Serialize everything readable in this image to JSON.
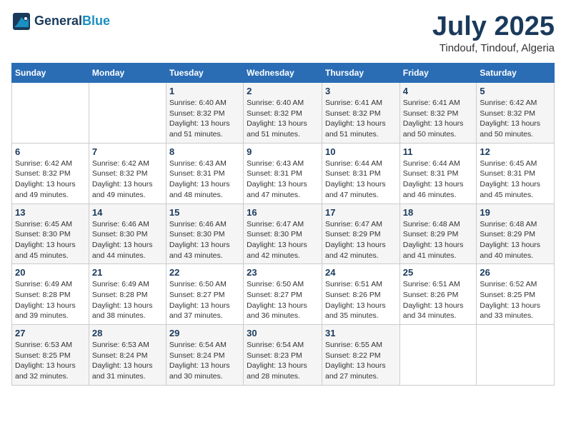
{
  "header": {
    "logo_line1": "General",
    "logo_line2": "Blue",
    "month": "July 2025",
    "location": "Tindouf, Tindouf, Algeria"
  },
  "weekdays": [
    "Sunday",
    "Monday",
    "Tuesday",
    "Wednesday",
    "Thursday",
    "Friday",
    "Saturday"
  ],
  "weeks": [
    [
      {
        "day": "",
        "info": ""
      },
      {
        "day": "",
        "info": ""
      },
      {
        "day": "1",
        "info": "Sunrise: 6:40 AM\nSunset: 8:32 PM\nDaylight: 13 hours and 51 minutes."
      },
      {
        "day": "2",
        "info": "Sunrise: 6:40 AM\nSunset: 8:32 PM\nDaylight: 13 hours and 51 minutes."
      },
      {
        "day": "3",
        "info": "Sunrise: 6:41 AM\nSunset: 8:32 PM\nDaylight: 13 hours and 51 minutes."
      },
      {
        "day": "4",
        "info": "Sunrise: 6:41 AM\nSunset: 8:32 PM\nDaylight: 13 hours and 50 minutes."
      },
      {
        "day": "5",
        "info": "Sunrise: 6:42 AM\nSunset: 8:32 PM\nDaylight: 13 hours and 50 minutes."
      }
    ],
    [
      {
        "day": "6",
        "info": "Sunrise: 6:42 AM\nSunset: 8:32 PM\nDaylight: 13 hours and 49 minutes."
      },
      {
        "day": "7",
        "info": "Sunrise: 6:42 AM\nSunset: 8:32 PM\nDaylight: 13 hours and 49 minutes."
      },
      {
        "day": "8",
        "info": "Sunrise: 6:43 AM\nSunset: 8:31 PM\nDaylight: 13 hours and 48 minutes."
      },
      {
        "day": "9",
        "info": "Sunrise: 6:43 AM\nSunset: 8:31 PM\nDaylight: 13 hours and 47 minutes."
      },
      {
        "day": "10",
        "info": "Sunrise: 6:44 AM\nSunset: 8:31 PM\nDaylight: 13 hours and 47 minutes."
      },
      {
        "day": "11",
        "info": "Sunrise: 6:44 AM\nSunset: 8:31 PM\nDaylight: 13 hours and 46 minutes."
      },
      {
        "day": "12",
        "info": "Sunrise: 6:45 AM\nSunset: 8:31 PM\nDaylight: 13 hours and 45 minutes."
      }
    ],
    [
      {
        "day": "13",
        "info": "Sunrise: 6:45 AM\nSunset: 8:30 PM\nDaylight: 13 hours and 45 minutes."
      },
      {
        "day": "14",
        "info": "Sunrise: 6:46 AM\nSunset: 8:30 PM\nDaylight: 13 hours and 44 minutes."
      },
      {
        "day": "15",
        "info": "Sunrise: 6:46 AM\nSunset: 8:30 PM\nDaylight: 13 hours and 43 minutes."
      },
      {
        "day": "16",
        "info": "Sunrise: 6:47 AM\nSunset: 8:30 PM\nDaylight: 13 hours and 42 minutes."
      },
      {
        "day": "17",
        "info": "Sunrise: 6:47 AM\nSunset: 8:29 PM\nDaylight: 13 hours and 42 minutes."
      },
      {
        "day": "18",
        "info": "Sunrise: 6:48 AM\nSunset: 8:29 PM\nDaylight: 13 hours and 41 minutes."
      },
      {
        "day": "19",
        "info": "Sunrise: 6:48 AM\nSunset: 8:29 PM\nDaylight: 13 hours and 40 minutes."
      }
    ],
    [
      {
        "day": "20",
        "info": "Sunrise: 6:49 AM\nSunset: 8:28 PM\nDaylight: 13 hours and 39 minutes."
      },
      {
        "day": "21",
        "info": "Sunrise: 6:49 AM\nSunset: 8:28 PM\nDaylight: 13 hours and 38 minutes."
      },
      {
        "day": "22",
        "info": "Sunrise: 6:50 AM\nSunset: 8:27 PM\nDaylight: 13 hours and 37 minutes."
      },
      {
        "day": "23",
        "info": "Sunrise: 6:50 AM\nSunset: 8:27 PM\nDaylight: 13 hours and 36 minutes."
      },
      {
        "day": "24",
        "info": "Sunrise: 6:51 AM\nSunset: 8:26 PM\nDaylight: 13 hours and 35 minutes."
      },
      {
        "day": "25",
        "info": "Sunrise: 6:51 AM\nSunset: 8:26 PM\nDaylight: 13 hours and 34 minutes."
      },
      {
        "day": "26",
        "info": "Sunrise: 6:52 AM\nSunset: 8:25 PM\nDaylight: 13 hours and 33 minutes."
      }
    ],
    [
      {
        "day": "27",
        "info": "Sunrise: 6:53 AM\nSunset: 8:25 PM\nDaylight: 13 hours and 32 minutes."
      },
      {
        "day": "28",
        "info": "Sunrise: 6:53 AM\nSunset: 8:24 PM\nDaylight: 13 hours and 31 minutes."
      },
      {
        "day": "29",
        "info": "Sunrise: 6:54 AM\nSunset: 8:24 PM\nDaylight: 13 hours and 30 minutes."
      },
      {
        "day": "30",
        "info": "Sunrise: 6:54 AM\nSunset: 8:23 PM\nDaylight: 13 hours and 28 minutes."
      },
      {
        "day": "31",
        "info": "Sunrise: 6:55 AM\nSunset: 8:22 PM\nDaylight: 13 hours and 27 minutes."
      },
      {
        "day": "",
        "info": ""
      },
      {
        "day": "",
        "info": ""
      }
    ]
  ]
}
